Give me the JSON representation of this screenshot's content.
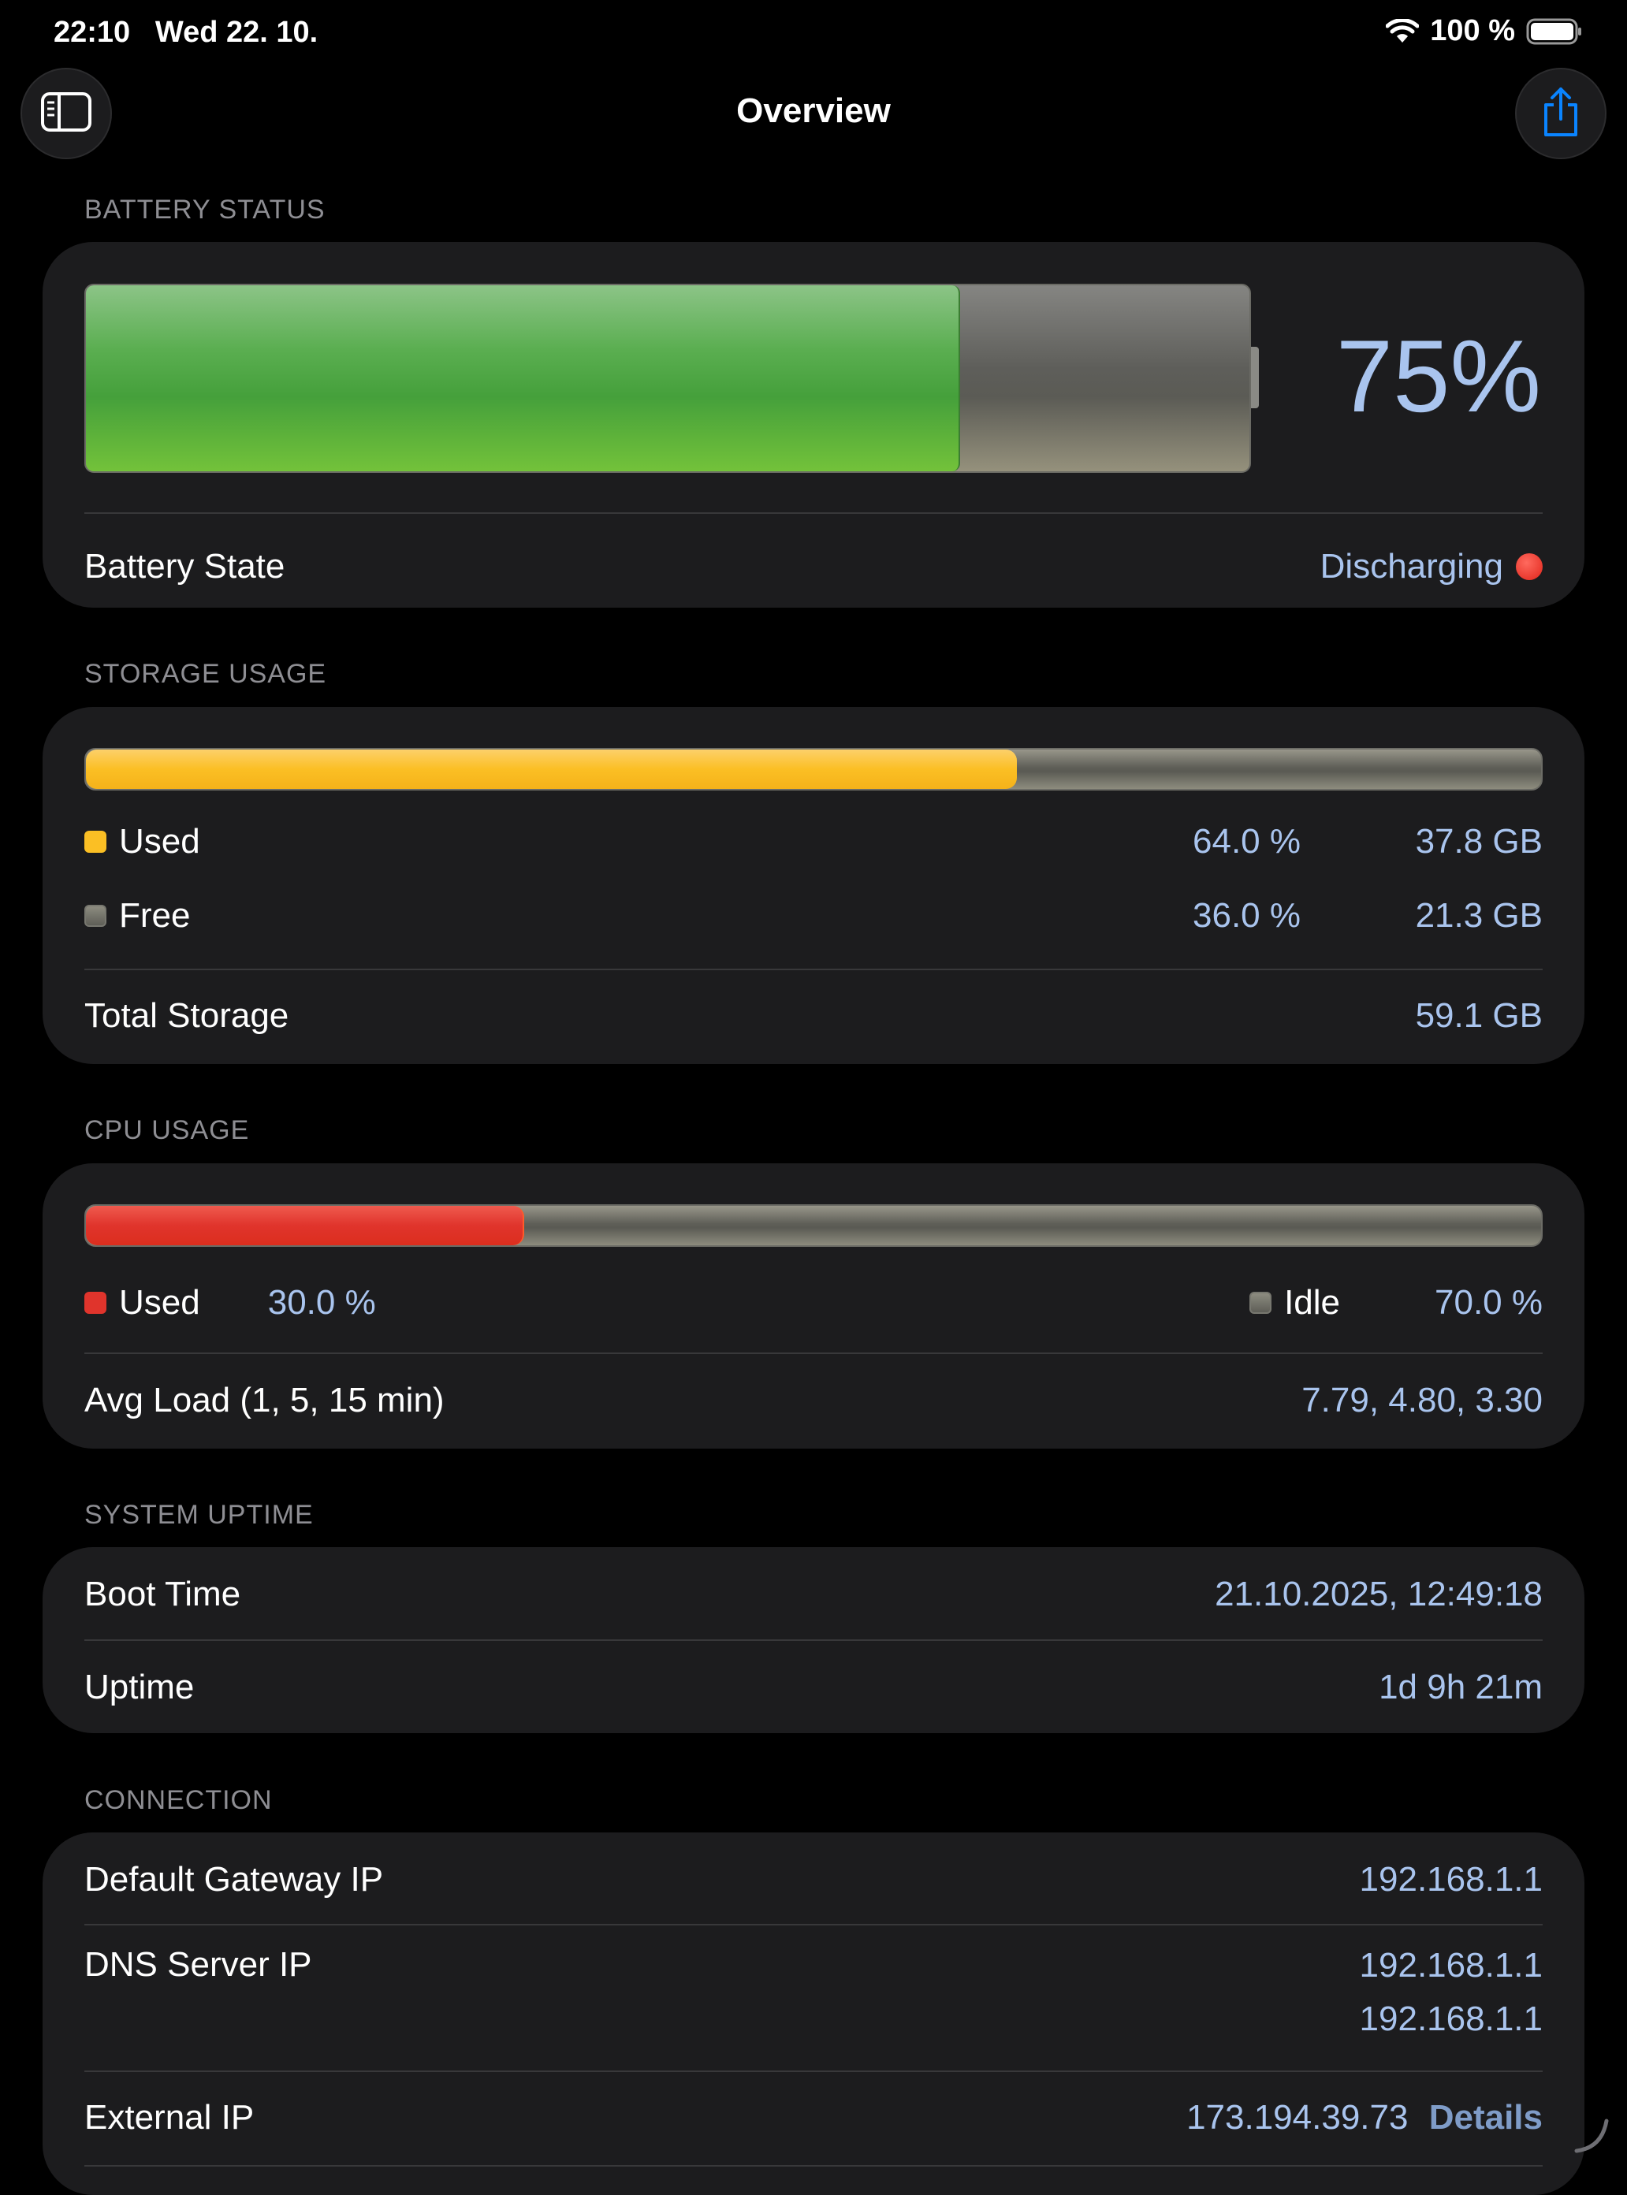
{
  "status_bar": {
    "time": "22:10",
    "date": "Wed 22. 10.",
    "battery_percent_text": "100 %"
  },
  "nav": {
    "title": "Overview"
  },
  "battery": {
    "header": "BATTERY STATUS",
    "level": 0.75,
    "percent_text": "75%",
    "state_label": "Battery State",
    "state_value": "Discharging"
  },
  "storage": {
    "header": "STORAGE USAGE",
    "used_fraction": 0.64,
    "rows": [
      {
        "label": "Used",
        "percent": "64.0 %",
        "size": "37.8 GB"
      },
      {
        "label": "Free",
        "percent": "36.0 %",
        "size": "21.3 GB"
      }
    ],
    "total_label": "Total Storage",
    "total_value": "59.1 GB"
  },
  "cpu": {
    "header": "CPU USAGE",
    "used_fraction": 0.3,
    "used_label": "Used",
    "used_value": "30.0 %",
    "idle_label": "Idle",
    "idle_value": "70.0 %",
    "load_label": "Avg Load (1, 5, 15 min)",
    "load_value": "7.79, 4.80, 3.30"
  },
  "uptime": {
    "header": "SYSTEM UPTIME",
    "boot_label": "Boot Time",
    "boot_value": "21.10.2025, 12:49:18",
    "uptime_label": "Uptime",
    "uptime_value": "1d 9h 21m"
  },
  "connection": {
    "header": "CONNECTION",
    "gateway_label": "Default Gateway IP",
    "gateway_value": "192.168.1.1",
    "dns_label": "DNS Server IP",
    "dns_values": [
      "192.168.1.1",
      "192.168.1.1"
    ],
    "external_label": "External IP",
    "external_value": "173.194.39.73",
    "details_link": "Details"
  },
  "colors": {
    "battery_fill": "#4aa23c",
    "storage_used": "#fbbf24",
    "cpu_used": "#e0342c",
    "free_idle": "#6b6b62",
    "value_text": "#a9c4ee",
    "status_red": "#ff3b30",
    "accent_blue": "#0a84ff"
  }
}
